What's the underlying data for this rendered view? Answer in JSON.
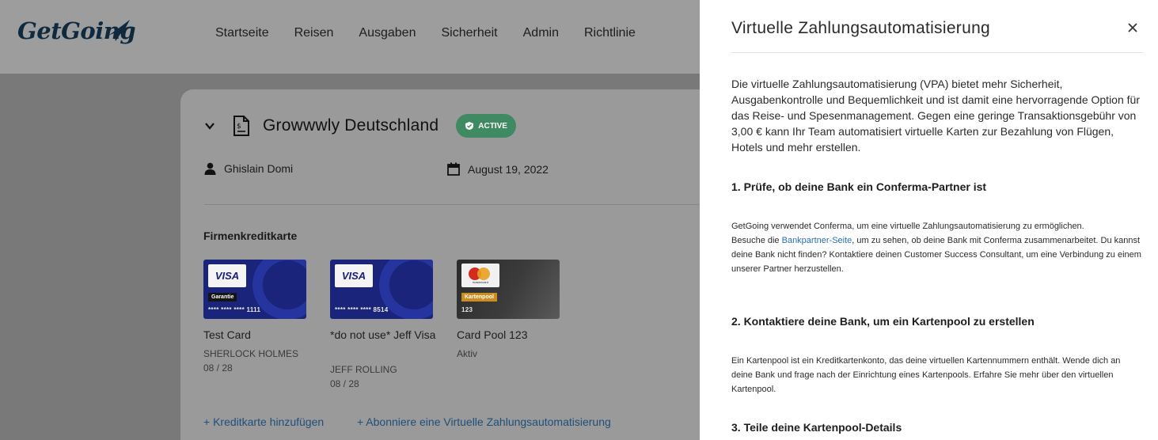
{
  "app": {
    "logo_text": "GetGoing",
    "nav": [
      "Startseite",
      "Reisen",
      "Ausgaben",
      "Sicherheit",
      "Admin",
      "Richtlinie"
    ]
  },
  "trip": {
    "title": "Growwwly Deutschland",
    "status_badge": "ACTIVE",
    "traveler": "Ghislain Domi",
    "date": "August 19, 2022"
  },
  "cards_section": {
    "label": "Firmenkreditkarte",
    "cards": [
      {
        "brand": "VISA",
        "tag": "Garantie",
        "number": "**** **** **** 1111",
        "name": "Test Card",
        "holder": "SHERLOCK HOLMES",
        "expiry": "08 / 28"
      },
      {
        "brand": "VISA",
        "number": "**** **** **** 8514",
        "name": "*do not use* Jeff Visa",
        "holder": "JEFF ROLLING",
        "expiry": "08 / 28"
      },
      {
        "brand": "mastercard",
        "tag": "Kartenpool",
        "number": "123",
        "name": "Card Pool 123",
        "status": "Aktiv"
      }
    ],
    "add_card_link": "+ Kreditkarte hinzufügen",
    "subscribe_link": "+ Abonniere eine Virtuelle Zahlungsautomatisierung"
  },
  "drawer": {
    "title": "Virtuelle Zahlungsautomatisierung",
    "intro": "Die virtuelle Zahlungsautomatisierung (VPA) bietet mehr Sicherheit, Ausgabenkontrolle und Bequemlichkeit und ist damit eine hervorragende Option für das Reise- und Spesenmanagement. Gegen eine geringe Transaktionsgebühr von 3,00 € kann Ihr Team automatisiert virtuelle Karten zur Bezahlung von Flügen, Hotels und mehr erstellen.",
    "step1": {
      "heading": "1. Prüfe, ob deine Bank ein Conferma-Partner ist",
      "text_a": "GetGoing verwendet Conferma, um eine virtuelle Zahlungsautomatisierung zu ermöglichen.",
      "text_b_pre": "Besuche die ",
      "link": "Bankpartner-Seite",
      "text_b_post": ", um zu sehen, ob deine Bank mit Conferma zusammenarbeitet. Du kannst deine Bank nicht finden? Kontaktiere deinen Customer Success Consultant, um eine Verbindung zu einem unserer Partner herzustellen."
    },
    "step2": {
      "heading": "2. Kontaktiere deine Bank, um ein Kartenpool zu erstellen",
      "text": "Ein Kartenpool ist ein Kreditkartenkonto, das deine virtuellen Kartennummern enthält. Wende dich an deine Bank und frage nach der Einrichtung eines Kartenpools. Erfahre Sie mehr über den virtuellen Kartenpool."
    },
    "step3": {
      "heading": "3. Teile deine Kartenpool-Details"
    }
  },
  "colors": {
    "accent_link": "#2a6eb0",
    "badge_green": "#3f8a62",
    "card_blue": "#19247a"
  }
}
